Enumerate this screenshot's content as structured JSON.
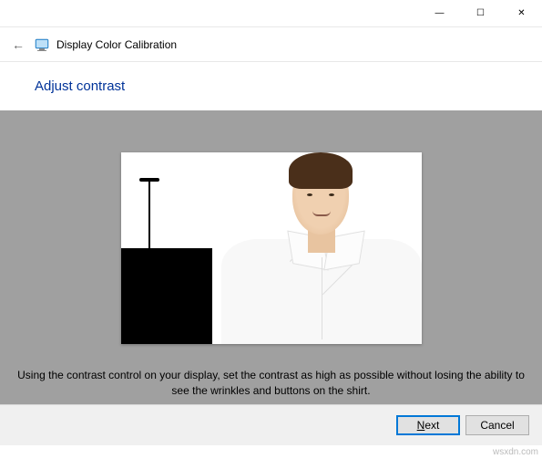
{
  "window": {
    "app_title": "Display Color Calibration",
    "minimize_glyph": "—",
    "maximize_glyph": "☐",
    "close_glyph": "✕",
    "back_glyph": "←"
  },
  "page": {
    "heading": "Adjust contrast",
    "instruction": "Using the contrast control on your display, set the contrast as high as possible without losing the ability to see the wrinkles and buttons on the shirt."
  },
  "footer": {
    "next_prefix": "N",
    "next_rest": "ext",
    "cancel_label": "Cancel"
  },
  "watermark": "wsxdn.com",
  "colors": {
    "heading": "#003399",
    "content_bg": "#a0a0a0",
    "footer_bg": "#f0f0f0"
  },
  "icons": {
    "app": "display-calibration-icon",
    "back": "back-arrow-icon"
  }
}
